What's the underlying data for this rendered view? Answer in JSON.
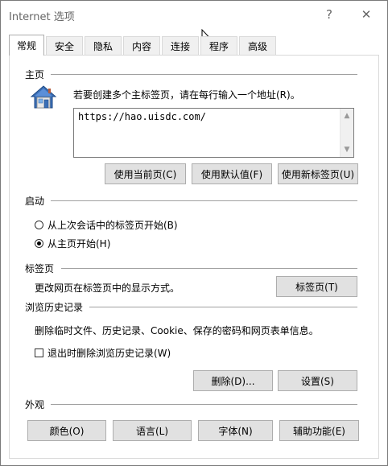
{
  "window": {
    "title": "Internet 选项",
    "help_label": "?",
    "close_label": "✕"
  },
  "tabs": [
    {
      "label": "常规"
    },
    {
      "label": "安全"
    },
    {
      "label": "隐私"
    },
    {
      "label": "内容"
    },
    {
      "label": "连接"
    },
    {
      "label": "程序"
    },
    {
      "label": "高级"
    }
  ],
  "home": {
    "header": "主页",
    "instruction": "若要创建多个主标签页，请在每行输入一个地址(R)。",
    "url_value": "https://hao.uisdc.com/",
    "buttons": {
      "use_current": "使用当前页(C)",
      "use_default": "使用默认值(F)",
      "use_new_tab": "使用新标签页(U)"
    }
  },
  "startup": {
    "header": "启动",
    "option_last_session": "从上次会话中的标签页开始(B)",
    "option_home": "从主页开始(H)",
    "selected": "home"
  },
  "tabs_section": {
    "header": "标签页",
    "description": "更改网页在标签页中的显示方式。",
    "button": "标签页(T)"
  },
  "history": {
    "header": "浏览历史记录",
    "description": "删除临时文件、历史记录、Cookie、保存的密码和网页表单信息。",
    "checkbox_label": "退出时删除浏览历史记录(W)",
    "checkbox_checked": false,
    "delete_button": "删除(D)...",
    "settings_button": "设置(S)"
  },
  "appearance": {
    "header": "外观",
    "buttons": {
      "colors": "颜色(O)",
      "languages": "语言(L)",
      "fonts": "字体(N)",
      "accessibility": "辅助功能(E)"
    }
  }
}
